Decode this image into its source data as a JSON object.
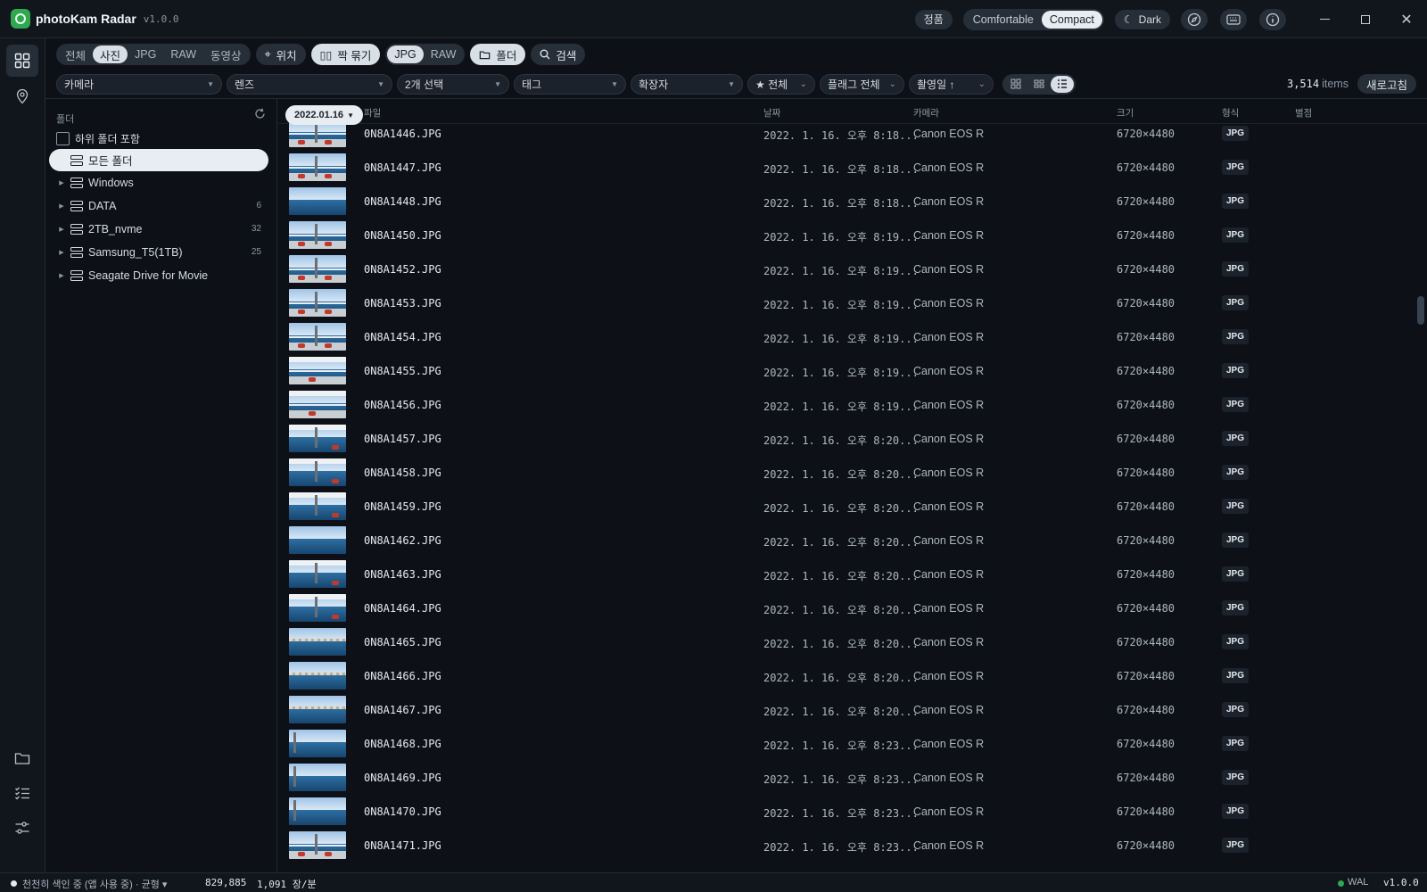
{
  "app": {
    "name": "photoKam Radar",
    "version": "v1.0.0",
    "license_label": "정품",
    "density": [
      "Comfortable",
      "Compact"
    ],
    "density_active": "Compact",
    "theme_label": "Dark"
  },
  "filters": {
    "media_tabs": [
      "전체",
      "사진",
      "JPG",
      "RAW",
      "동영상"
    ],
    "media_active": "사진",
    "location_label": "위치",
    "pair_label": "짝 묶기",
    "pair_tabs": [
      "JPG",
      "RAW"
    ],
    "pair_active": "JPG",
    "folder_label": "폴더",
    "search_label": "검색"
  },
  "dropdowns": {
    "camera": "카메라",
    "lens": "렌즈",
    "selection": "2개 선택",
    "tag": "태그",
    "extension": "확장자",
    "rating": "★ 전체",
    "flag": "플래그 전체",
    "sort": "촬영일 ↑"
  },
  "summary": {
    "count": "3,514",
    "unit": "items",
    "refresh_label": "새로고침"
  },
  "folder_panel": {
    "title": "폴더",
    "include_subfolders": "하위 폴더 포함",
    "items": [
      {
        "label": "모든 폴더",
        "count": ""
      },
      {
        "label": "Windows",
        "count": ""
      },
      {
        "label": "DATA",
        "count": "6"
      },
      {
        "label": "2TB_nvme",
        "count": "32"
      },
      {
        "label": "Samsung_T5(1TB)",
        "count": "25"
      },
      {
        "label": "Seagate Drive for Movie",
        "count": ""
      }
    ]
  },
  "list": {
    "date_group": "2022.01.16",
    "columns": [
      "파일",
      "날짜",
      "카메라",
      "크기",
      "형식",
      "별점"
    ],
    "rows": [
      {
        "name": "0N8A1446.JPG",
        "date": "2022. 1. 16. 오후 8:18...",
        "camera": "Canon EOS R",
        "size": "6720×4480",
        "type": "JPG"
      },
      {
        "name": "0N8A1447.JPG",
        "date": "2022. 1. 16. 오후 8:18...",
        "camera": "Canon EOS R",
        "size": "6720×4480",
        "type": "JPG"
      },
      {
        "name": "0N8A1448.JPG",
        "date": "2022. 1. 16. 오후 8:18...",
        "camera": "Canon EOS R",
        "size": "6720×4480",
        "type": "JPG"
      },
      {
        "name": "0N8A1450.JPG",
        "date": "2022. 1. 16. 오후 8:19...",
        "camera": "Canon EOS R",
        "size": "6720×4480",
        "type": "JPG"
      },
      {
        "name": "0N8A1452.JPG",
        "date": "2022. 1. 16. 오후 8:19...",
        "camera": "Canon EOS R",
        "size": "6720×4480",
        "type": "JPG"
      },
      {
        "name": "0N8A1453.JPG",
        "date": "2022. 1. 16. 오후 8:19...",
        "camera": "Canon EOS R",
        "size": "6720×4480",
        "type": "JPG"
      },
      {
        "name": "0N8A1454.JPG",
        "date": "2022. 1. 16. 오후 8:19...",
        "camera": "Canon EOS R",
        "size": "6720×4480",
        "type": "JPG"
      },
      {
        "name": "0N8A1455.JPG",
        "date": "2022. 1. 16. 오후 8:19...",
        "camera": "Canon EOS R",
        "size": "6720×4480",
        "type": "JPG"
      },
      {
        "name": "0N8A1456.JPG",
        "date": "2022. 1. 16. 오후 8:19...",
        "camera": "Canon EOS R",
        "size": "6720×4480",
        "type": "JPG"
      },
      {
        "name": "0N8A1457.JPG",
        "date": "2022. 1. 16. 오후 8:20...",
        "camera": "Canon EOS R",
        "size": "6720×4480",
        "type": "JPG"
      },
      {
        "name": "0N8A1458.JPG",
        "date": "2022. 1. 16. 오후 8:20...",
        "camera": "Canon EOS R",
        "size": "6720×4480",
        "type": "JPG"
      },
      {
        "name": "0N8A1459.JPG",
        "date": "2022. 1. 16. 오후 8:20...",
        "camera": "Canon EOS R",
        "size": "6720×4480",
        "type": "JPG"
      },
      {
        "name": "0N8A1462.JPG",
        "date": "2022. 1. 16. 오후 8:20...",
        "camera": "Canon EOS R",
        "size": "6720×4480",
        "type": "JPG"
      },
      {
        "name": "0N8A1463.JPG",
        "date": "2022. 1. 16. 오후 8:20...",
        "camera": "Canon EOS R",
        "size": "6720×4480",
        "type": "JPG"
      },
      {
        "name": "0N8A1464.JPG",
        "date": "2022. 1. 16. 오후 8:20...",
        "camera": "Canon EOS R",
        "size": "6720×4480",
        "type": "JPG"
      },
      {
        "name": "0N8A1465.JPG",
        "date": "2022. 1. 16. 오후 8:20...",
        "camera": "Canon EOS R",
        "size": "6720×4480",
        "type": "JPG"
      },
      {
        "name": "0N8A1466.JPG",
        "date": "2022. 1. 16. 오후 8:20...",
        "camera": "Canon EOS R",
        "size": "6720×4480",
        "type": "JPG"
      },
      {
        "name": "0N8A1467.JPG",
        "date": "2022. 1. 16. 오후 8:20...",
        "camera": "Canon EOS R",
        "size": "6720×4480",
        "type": "JPG"
      },
      {
        "name": "0N8A1468.JPG",
        "date": "2022. 1. 16. 오후 8:23...",
        "camera": "Canon EOS R",
        "size": "6720×4480",
        "type": "JPG"
      },
      {
        "name": "0N8A1469.JPG",
        "date": "2022. 1. 16. 오후 8:23...",
        "camera": "Canon EOS R",
        "size": "6720×4480",
        "type": "JPG"
      },
      {
        "name": "0N8A1470.JPG",
        "date": "2022. 1. 16. 오후 8:23...",
        "camera": "Canon EOS R",
        "size": "6720×4480",
        "type": "JPG"
      },
      {
        "name": "0N8A1471.JPG",
        "date": "2022. 1. 16. 오후 8:23...",
        "camera": "Canon EOS R",
        "size": "6720×4480",
        "type": "JPG"
      }
    ]
  },
  "status": {
    "indexing": "천천히 색인 중 (앱 사용 중) · 균형 ▾",
    "indexed_count": "829,885",
    "rate": "1,091 장/분",
    "wal": "WAL",
    "version": "v1.0.0"
  },
  "colors": {
    "background": "#0d1117",
    "accent_green": "#2fa84f",
    "selected": "#e8edf2"
  }
}
